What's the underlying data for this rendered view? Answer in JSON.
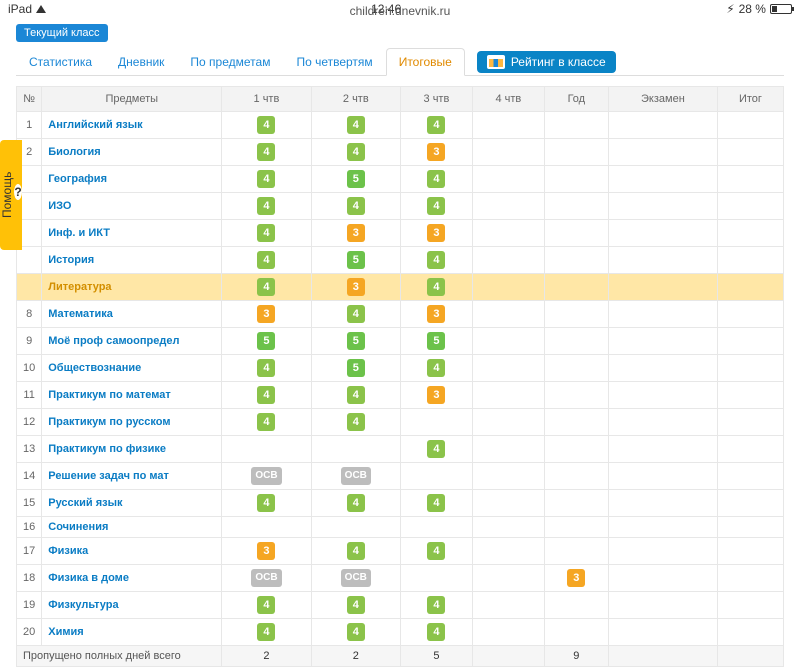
{
  "status": {
    "device": "iPad",
    "time": "12:46",
    "battery": "28 %"
  },
  "url": "children.dnevnik.ru",
  "current_class": "Текущий класс",
  "tabs": [
    "Статистика",
    "Дневник",
    "По предметам",
    "По четвертям",
    "Итоговые"
  ],
  "active_tab_index": 4,
  "rating_label": "Рейтинг в классе",
  "headers": {
    "num": "№",
    "subject": "Предметы",
    "q1": "1 чтв",
    "q2": "2 чтв",
    "q3": "3 чтв",
    "q4": "4 чтв",
    "year": "Год",
    "exam": "Экзамен",
    "final": "Итог"
  },
  "rows": [
    {
      "n": "1",
      "subject": "Английский язык",
      "q1": "4",
      "q2": "4",
      "q3": "4"
    },
    {
      "n": "2",
      "subject": "Биология",
      "q1": "4",
      "q2": "4",
      "q3": "3"
    },
    {
      "n": "",
      "subject": "География",
      "q1": "4",
      "q2": "5",
      "q3": "4"
    },
    {
      "n": "",
      "subject": "ИЗО",
      "q1": "4",
      "q2": "4",
      "q3": "4"
    },
    {
      "n": "",
      "subject": "Инф. и ИКТ",
      "q1": "4",
      "q2": "3",
      "q3": "3"
    },
    {
      "n": "",
      "subject": "История",
      "q1": "4",
      "q2": "5",
      "q3": "4"
    },
    {
      "n": "",
      "subject": "Литература",
      "q1": "4",
      "q2": "3",
      "q3": "4",
      "highlight": true
    },
    {
      "n": "8",
      "subject": "Математика",
      "q1": "3",
      "q2": "4",
      "q3": "3"
    },
    {
      "n": "9",
      "subject": "Моё проф самоопредел",
      "q1": "5",
      "q2": "5",
      "q3": "5"
    },
    {
      "n": "10",
      "subject": "Обществознание",
      "q1": "4",
      "q2": "5",
      "q3": "4"
    },
    {
      "n": "11",
      "subject": "Практикум по математ",
      "q1": "4",
      "q2": "4",
      "q3": "3"
    },
    {
      "n": "12",
      "subject": "Практикум по русском",
      "q1": "4",
      "q2": "4"
    },
    {
      "n": "13",
      "subject": "Практикум по физике",
      "q3": "4"
    },
    {
      "n": "14",
      "subject": "Решение задач по мат",
      "q1": "ОСВ",
      "q2": "ОСВ"
    },
    {
      "n": "15",
      "subject": "Русский язык",
      "q1": "4",
      "q2": "4",
      "q3": "4"
    },
    {
      "n": "16",
      "subject": "Сочинения"
    },
    {
      "n": "17",
      "subject": "Физика",
      "q1": "3",
      "q2": "4",
      "q3": "4"
    },
    {
      "n": "18",
      "subject": "Физика в доме",
      "q1": "ОСВ",
      "q2": "ОСВ",
      "year": "3"
    },
    {
      "n": "19",
      "subject": "Физкультура",
      "q1": "4",
      "q2": "4",
      "q3": "4"
    },
    {
      "n": "20",
      "subject": "Химия",
      "q1": "4",
      "q2": "4",
      "q3": "4"
    }
  ],
  "missed": {
    "label": "Пропущено полных дней всего",
    "q1": "2",
    "q2": "2",
    "q3": "5",
    "year": "9"
  },
  "help": {
    "label": "Помощь",
    "icon": "?"
  }
}
